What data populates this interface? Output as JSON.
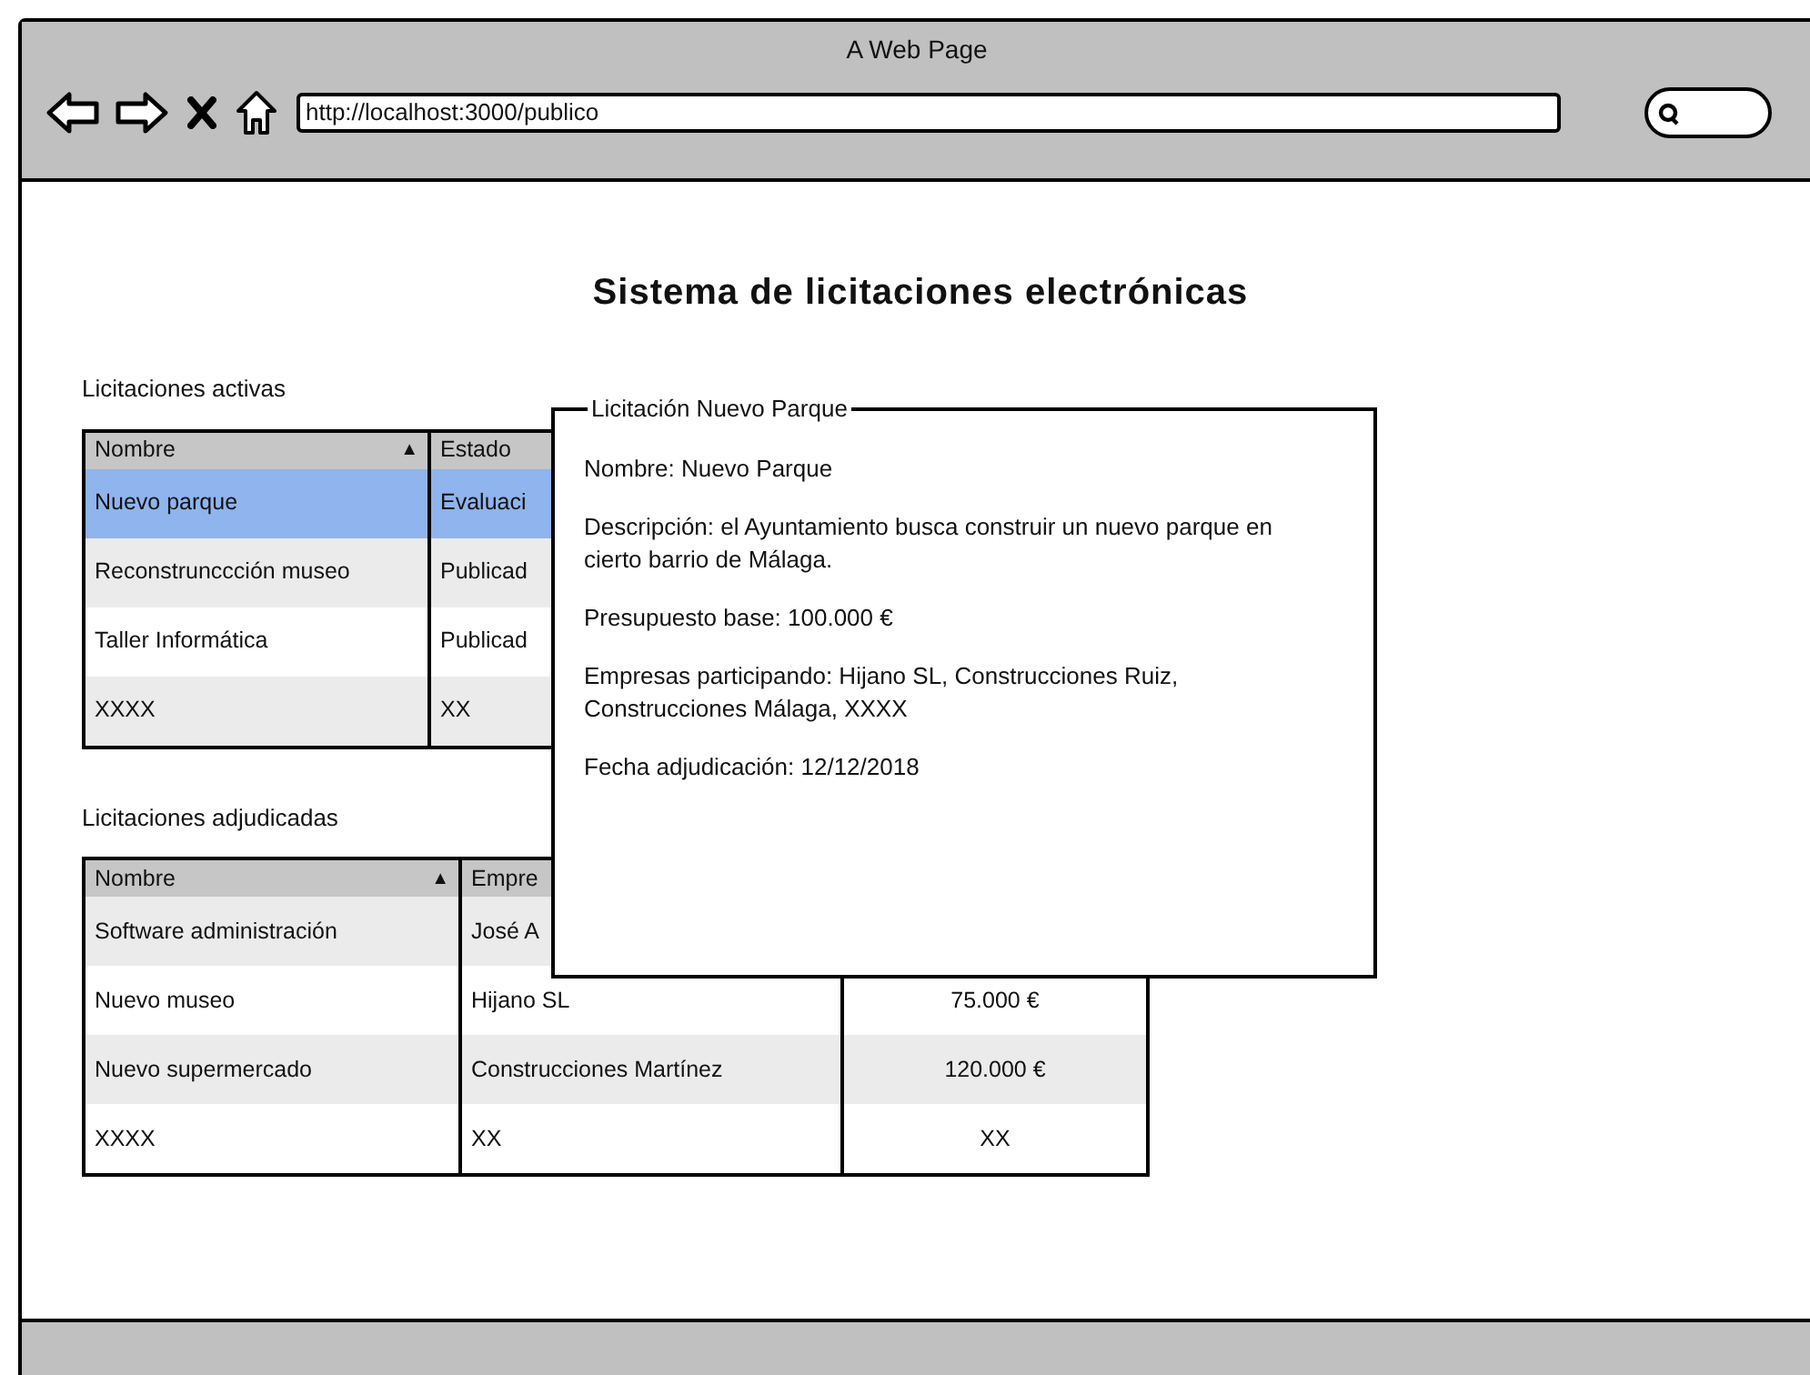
{
  "window": {
    "title": "A Web Page",
    "url": "http://localhost:3000/publico"
  },
  "page_title": "Sistema de licitaciones electrónicas",
  "active_tenders": {
    "heading": "Licitaciones activas",
    "columns": [
      {
        "label": "Nombre",
        "sort_indicator": "▲"
      },
      {
        "label": "Estado"
      }
    ],
    "rows": [
      {
        "cells": [
          "Nuevo parque",
          "Evaluaci"
        ],
        "selected": true
      },
      {
        "cells": [
          "Reconstrunccción museo",
          "Publicad"
        ],
        "selected": false
      },
      {
        "cells": [
          "Taller Informática",
          "Publicad"
        ],
        "selected": false
      },
      {
        "cells": [
          "XXXX",
          "XX"
        ],
        "selected": false
      }
    ]
  },
  "awarded_tenders": {
    "heading": "Licitaciones adjudicadas",
    "columns": [
      {
        "label": "Nombre",
        "sort_indicator": "▲"
      },
      {
        "label": "Empre"
      }
    ],
    "rows": [
      {
        "cells": [
          "Software administración",
          "José A"
        ]
      },
      {
        "cells": [
          "Nuevo museo",
          "Hijano SL",
          "75.000 €"
        ]
      },
      {
        "cells": [
          "Nuevo supermercado",
          "Construcciones Martínez",
          "120.000 €"
        ]
      },
      {
        "cells": [
          "XXXX",
          "XX",
          "XX"
        ]
      }
    ]
  },
  "detail_panel": {
    "title": "Licitación Nuevo Parque",
    "lines": [
      "Nombre: Nuevo Parque",
      "Descripción: el Ayuntamiento busca construir un nuevo parque en cierto barrio de Málaga.",
      "Presupuesto base: 100.000 €",
      "Empresas participando: Hijano SL, Construcciones Ruiz, Construcciones Málaga, XXXX",
      "Fecha adjudicación: 12/12/2018"
    ]
  }
}
